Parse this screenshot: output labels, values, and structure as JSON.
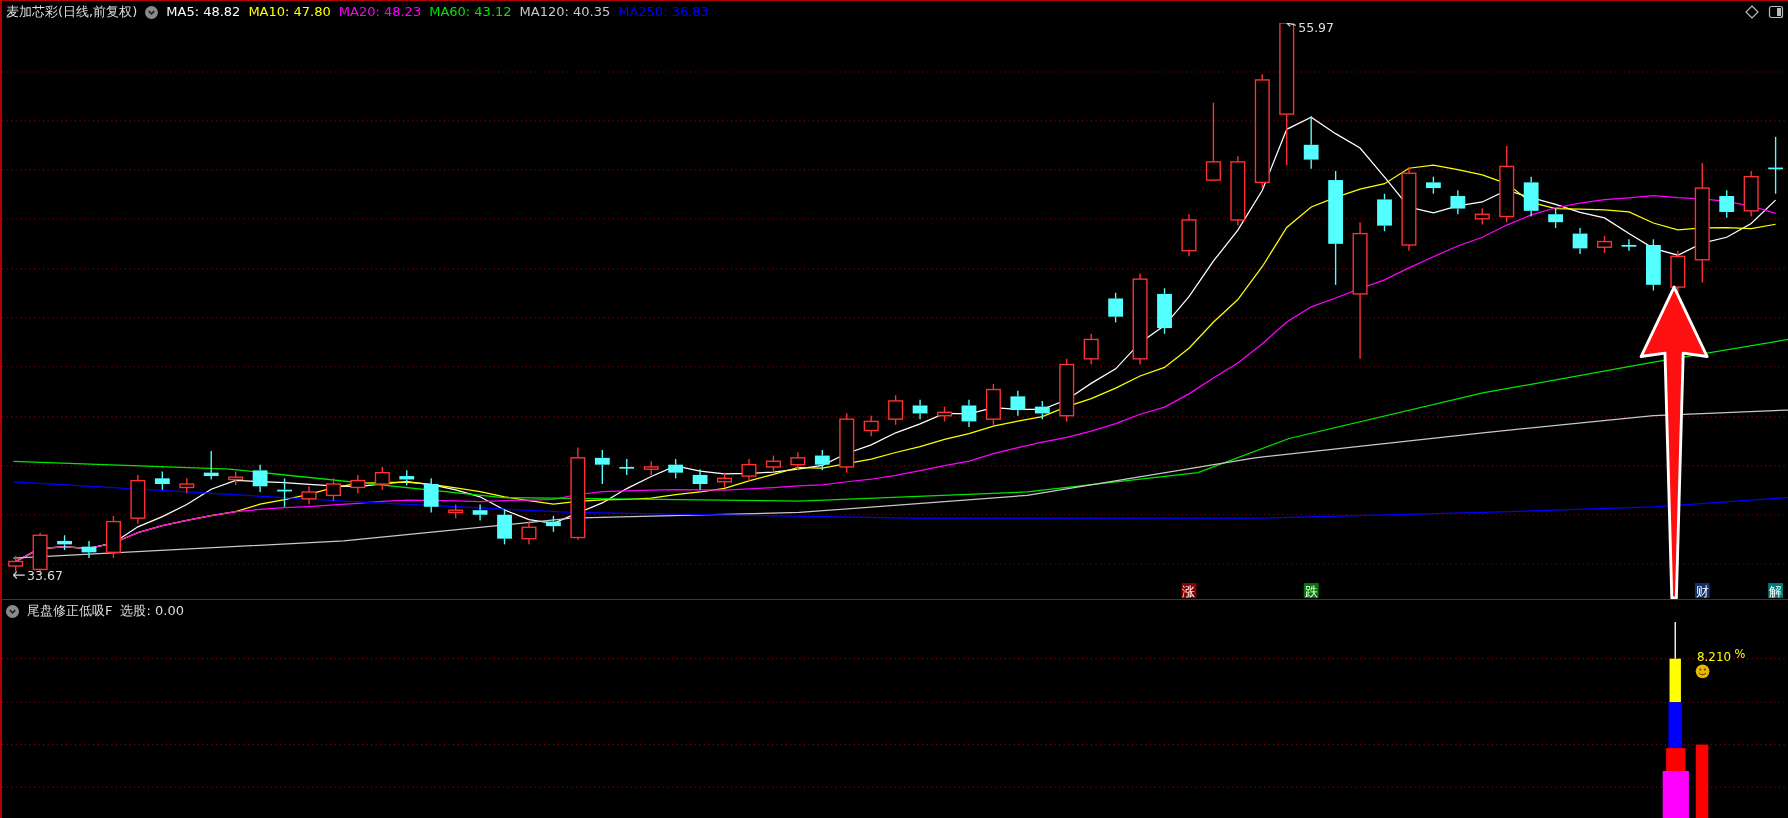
{
  "chart": {
    "title": "麦加芯彩(日线,前复权)",
    "ma_legend": [
      {
        "label": "MA5: 48.82",
        "color": "#ffffff"
      },
      {
        "label": "MA10: 47.80",
        "color": "#ffff00"
      },
      {
        "label": "MA20: 48.23",
        "color": "#ff00ff"
      },
      {
        "label": "MA60: 43.12",
        "color": "#00e600"
      },
      {
        "label": "MA120: 40.35",
        "color": "#c8c8c8"
      },
      {
        "label": "MA250: 36.83",
        "color": "#0000ff"
      }
    ],
    "high_label": "55.97",
    "low_label": "33.67",
    "events": [
      {
        "label": "涨",
        "color": "#8b0000"
      },
      {
        "label": "跌",
        "color": "#007a00"
      },
      {
        "label": "财",
        "color": "#10306e"
      },
      {
        "label": "解",
        "color": "#007b7b"
      }
    ]
  },
  "indicator": {
    "title": "尾盘修正低吸F",
    "reading": "选股: 0.00",
    "value": "8.210",
    "unit": "%"
  }
}
